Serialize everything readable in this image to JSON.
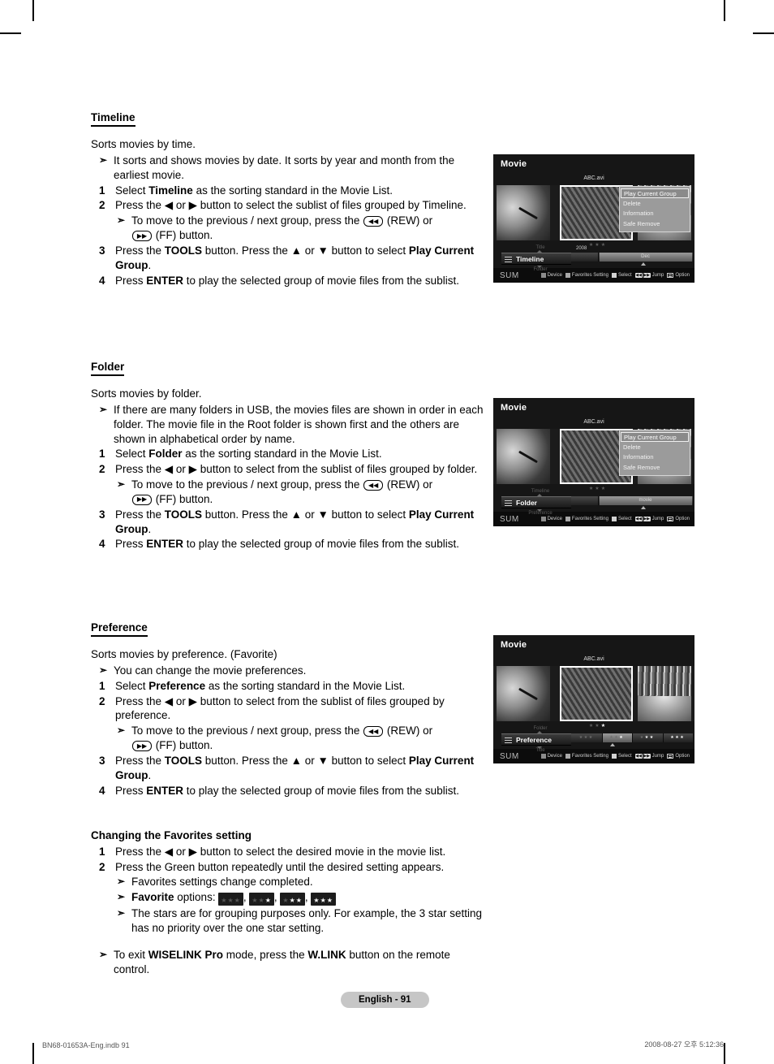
{
  "document": {
    "page_badge": "English - 91",
    "footer_left": "BN68-01653A-Eng.indb   91",
    "footer_right": "2008-08-27   오후 5:12:36"
  },
  "sections": [
    {
      "heading": "Timeline",
      "lead": "Sorts movies by time.",
      "note": "It sorts and shows movies by date. It sorts by year and month from the earliest movie.",
      "steps": [
        {
          "num": "1",
          "pre": "Select ",
          "bold": "Timeline",
          "post": " as the sorting standard in the Movie List."
        },
        {
          "num": "2",
          "pre": "Press the ",
          "bold": "",
          "post": " button to select the sublist of files grouped by Timeline."
        },
        {
          "num": "3",
          "pre": "Press the ",
          "bold": "TOOLS",
          "post": " button. Press the ▲ or ▼ button to select ",
          "bold2": "Play Current Group",
          "post2": "."
        },
        {
          "num": "4",
          "pre": "Press ",
          "bold": "ENTER",
          "post": "  to play the selected group of movie files from the sublist."
        }
      ],
      "step2_text_a": "Press the ◀ or ▶ button to select the sublist of files grouped by Timeline.",
      "subnote_a": "To move to the previous / next group, press the ",
      "subnote_b": " (REW) or ",
      "subnote_c": " (FF) button."
    },
    {
      "heading": "Folder",
      "lead": "Sorts movies by folder.",
      "note": "If there are many folders in USB, the movies files are shown in order in each folder. The movie file in the Root folder is shown first and the others are shown in alphabetical order by name.",
      "step1_pre": "Select ",
      "step1_bold": "Folder",
      "step1_post": " as the sorting standard in the Movie List.",
      "step2_text": "Press the ◀ or ▶ button to select from the sublist of files grouped by folder."
    },
    {
      "heading": "Preference",
      "lead": "Sorts movies by preference. (Favorite)",
      "note": "You can change the movie preferences.",
      "step1_pre": "Select ",
      "step1_bold": "Preference",
      "step1_post": " as the sorting standard in the Movie List.",
      "step2_text": "Press the ◀ or ▶ button to select from the sublist of files grouped by preference."
    }
  ],
  "shared": {
    "step2_prefix": "Press the ◀ or ▶ button to select from the sublist of files grouped by ",
    "step1_timeline_text": "Press the ◀ or ▶ button to select the sublist of files grouped by Timeline.",
    "submove_pre": "To move to the previous / next group, press the ",
    "submove_mid": " (REW) or ",
    "submove_end": " (FF) button.",
    "step3_pre": "Press the ",
    "step3_tools": "TOOLS",
    "step3_mid": " button. Press the ▲ or ▼ button to select ",
    "step3_bold": "Play Current Group",
    "step3_end": ".",
    "step4_pre": "Press ",
    "step4_enter": "ENTER",
    "step4_post": "  to play the selected group of movie files from the sublist.",
    "rew_glyph": "◀◀",
    "ff_glyph": "▶▶"
  },
  "favorites": {
    "heading": "Changing the Favorites setting",
    "step1": "Press the ◀ or ▶ button to select the desired movie in the movie list.",
    "step2": "Press the Green button repeatedly until the desired setting appears.",
    "note1": "Favorites settings change completed.",
    "note2_bold": "Favorite",
    "note2_rest": " options: ",
    "note3": "The stars are for grouping purposes only. For example, the 3 star setting has no priority over the one star setting.",
    "options": [
      {
        "filled": 0,
        "total": 3
      },
      {
        "filled": 1,
        "total": 3
      },
      {
        "filled": 2,
        "total": 3
      },
      {
        "filled": 3,
        "total": 3
      }
    ],
    "exit_pre": "To exit ",
    "exit_bold1": "WISELINK Pro",
    "exit_mid": " mode, press the ",
    "exit_bold2": "W.LINK",
    "exit_post": " button on the remote control."
  },
  "screenshots": [
    {
      "id": "timeline",
      "title": "Movie",
      "filename": "ABC.avi",
      "stars": {
        "filled": 0,
        "total": 3
      },
      "menu": {
        "items": [
          "Play Current Group",
          "Delete",
          "Information",
          "Safe Remove"
        ],
        "selected_index": 0
      },
      "sort": {
        "above": "Title",
        "current": "Timeline",
        "below": "Folder"
      },
      "groupbar": {
        "year_label": "2008",
        "segment_label": "Dec",
        "mode": "label"
      },
      "status": {
        "sum": "SUM",
        "legend": [
          {
            "type": "square",
            "color": "red",
            "label": "Device"
          },
          {
            "type": "square",
            "color": "green",
            "label": "Favorites Setting"
          },
          {
            "type": "square",
            "color": "yellow",
            "label": "Select"
          },
          {
            "type": "keys",
            "label": "Jump"
          },
          {
            "type": "option",
            "label": "Option"
          }
        ]
      }
    },
    {
      "id": "folder",
      "title": "Movie",
      "filename": "ABC.avi",
      "stars": {
        "filled": 0,
        "total": 3
      },
      "menu": {
        "items": [
          "Play Current Group",
          "Delete",
          "Information",
          "Safe Remove"
        ],
        "selected_index": 0
      },
      "sort": {
        "above": "Timeline",
        "current": "Folder",
        "below": "Preference"
      },
      "groupbar": {
        "year_label": "",
        "segment_label": "movie",
        "mode": "label"
      },
      "status": {
        "sum": "SUM",
        "legend": [
          {
            "type": "square",
            "color": "red",
            "label": "Device"
          },
          {
            "type": "square",
            "color": "green",
            "label": "Favorites Setting"
          },
          {
            "type": "square",
            "color": "yellow",
            "label": "Select"
          },
          {
            "type": "keys",
            "label": "Jump"
          },
          {
            "type": "option",
            "label": "Option"
          }
        ]
      }
    },
    {
      "id": "preference",
      "title": "Movie",
      "filename": "ABC.avi",
      "stars": {
        "filled": 1,
        "total": 3
      },
      "menu": null,
      "sort": {
        "above": "Folder",
        "current": "Preference",
        "below": "Title"
      },
      "groupbar": {
        "mode": "stars",
        "groups": [
          {
            "filled": 0,
            "total": 3,
            "selected": false
          },
          {
            "filled": 1,
            "total": 3,
            "selected": true
          },
          {
            "filled": 2,
            "total": 3,
            "selected": false
          },
          {
            "filled": 3,
            "total": 3,
            "selected": false
          }
        ]
      },
      "status": {
        "sum": "SUM",
        "legend": [
          {
            "type": "square",
            "color": "red",
            "label": "Device"
          },
          {
            "type": "square",
            "color": "green",
            "label": "Favorites Setting"
          },
          {
            "type": "square",
            "color": "yellow",
            "label": "Select"
          },
          {
            "type": "keys",
            "label": "Jump"
          },
          {
            "type": "option",
            "label": "Option"
          }
        ]
      }
    }
  ]
}
